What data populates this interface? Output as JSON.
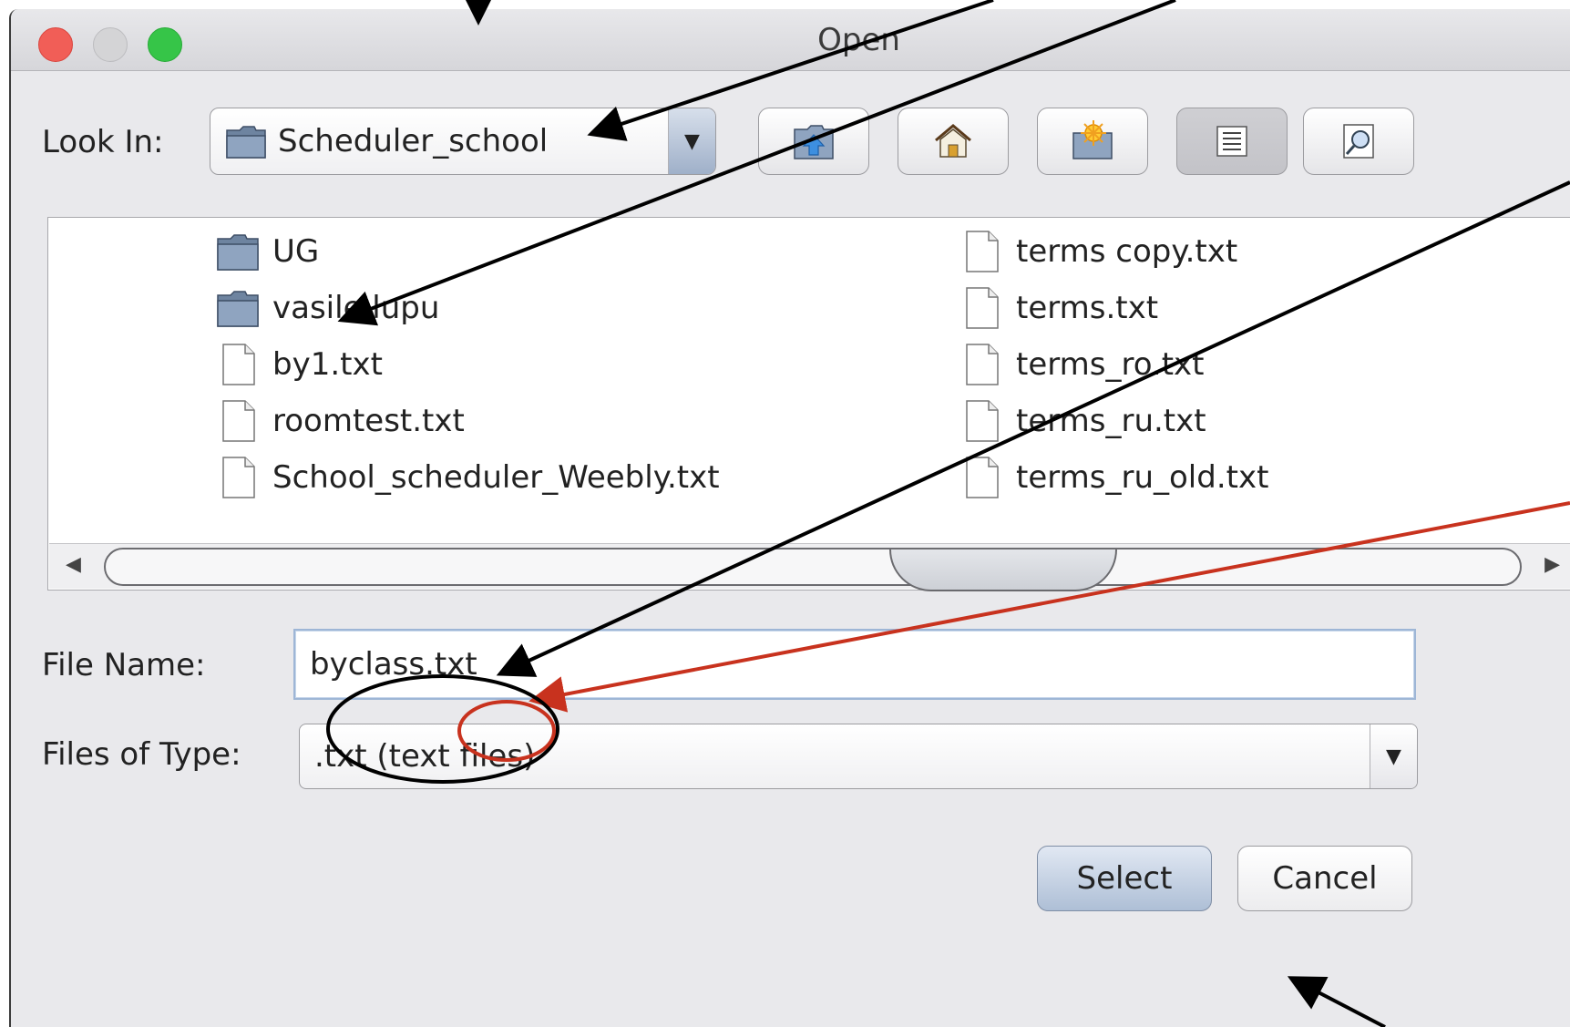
{
  "window": {
    "title": "Open"
  },
  "look_in": {
    "label": "Look In:",
    "value": "Scheduler_school",
    "folder_icon": "folder-icon",
    "dropdown_icon": "chevron-down-icon"
  },
  "toolbar": [
    {
      "name": "up-folder-button",
      "icon": "up-folder-icon"
    },
    {
      "name": "home-button",
      "icon": "home-icon"
    },
    {
      "name": "new-folder-button",
      "icon": "new-folder-icon"
    },
    {
      "name": "list-view-button",
      "icon": "list-view-icon",
      "pressed": true
    },
    {
      "name": "details-view-button",
      "icon": "details-view-icon"
    }
  ],
  "files": {
    "column1": [
      {
        "name": "UG",
        "type": "folder"
      },
      {
        "name": "vasile lupu",
        "type": "folder"
      },
      {
        "name": "by1.txt",
        "type": "file"
      },
      {
        "name": "roomtest.txt",
        "type": "file"
      },
      {
        "name": "School_scheduler_Weebly.txt",
        "type": "file"
      }
    ],
    "column2": [
      {
        "name": "terms copy.txt",
        "type": "file"
      },
      {
        "name": "terms.txt",
        "type": "file"
      },
      {
        "name": "terms_ro.txt",
        "type": "file"
      },
      {
        "name": "terms_ru.txt",
        "type": "file"
      },
      {
        "name": "terms_ru_old.txt",
        "type": "file"
      }
    ]
  },
  "file_name": {
    "label": "File Name:",
    "value": "byclass.txt"
  },
  "files_of_type": {
    "label": "Files of Type:",
    "value": ".txt (text files)"
  },
  "buttons": {
    "select": "Select",
    "cancel": "Cancel"
  },
  "colors": {
    "annotation_black": "#000000",
    "annotation_red": "#c8321e",
    "accent": "#9eb6d6"
  }
}
